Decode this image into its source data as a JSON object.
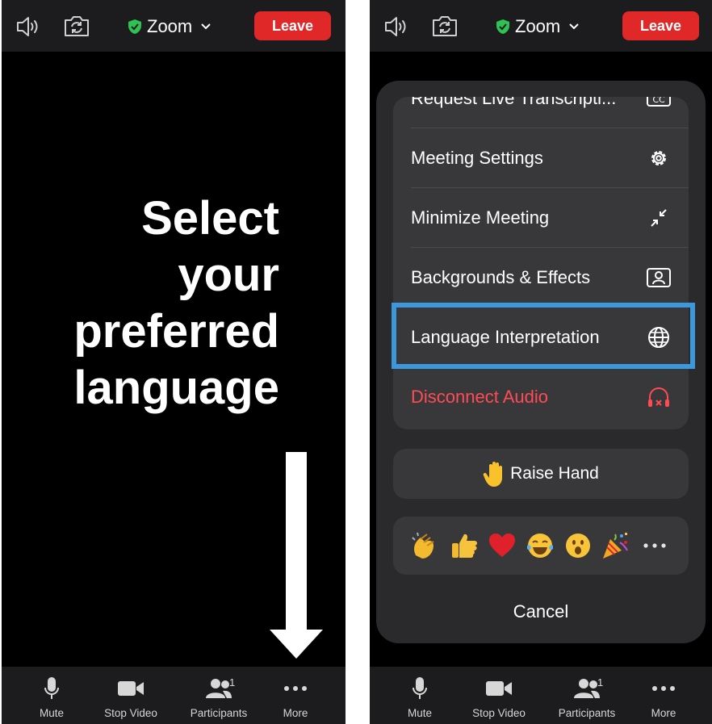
{
  "left": {
    "topbar": {
      "title": "Zoom",
      "leave_label": "Leave"
    },
    "instruction": {
      "line1": "Select",
      "line2": "your",
      "line3": "preferred",
      "line4": "language"
    },
    "toolbar": {
      "mute": "Mute",
      "stop_video": "Stop Video",
      "participants": "Participants",
      "participants_count": "1",
      "more": "More"
    }
  },
  "right": {
    "topbar": {
      "title": "Zoom",
      "leave_label": "Leave"
    },
    "menu": {
      "items": [
        {
          "label": "Request Live Transcripti...",
          "icon": "cc-icon"
        },
        {
          "label": "Meeting Settings",
          "icon": "gear-icon"
        },
        {
          "label": "Minimize Meeting",
          "icon": "minimize-icon"
        },
        {
          "label": "Backgrounds & Effects",
          "icon": "portrait-icon"
        },
        {
          "label": "Language Interpretation",
          "icon": "globe-icon"
        },
        {
          "label": "Disconnect Audio",
          "icon": "headphones-x-icon"
        }
      ]
    },
    "raise_hand": {
      "label": "Raise Hand",
      "icon": "raised-hand-icon"
    },
    "reactions": [
      "clapping-hands-icon",
      "thumbs-up-icon",
      "heart-icon",
      "tears-of-joy-icon",
      "surprised-face-icon",
      "party-popper-icon",
      "more-dots-icon"
    ],
    "cancel_label": "Cancel",
    "toolbar": {
      "mute": "Mute",
      "stop_video": "Stop Video",
      "participants": "Participants",
      "participants_count": "1",
      "more": "More"
    }
  },
  "colors": {
    "leave": "#e02828",
    "shield": "#2ec255",
    "highlight": "#3d97dc",
    "disconnect": "#ff4b56"
  }
}
